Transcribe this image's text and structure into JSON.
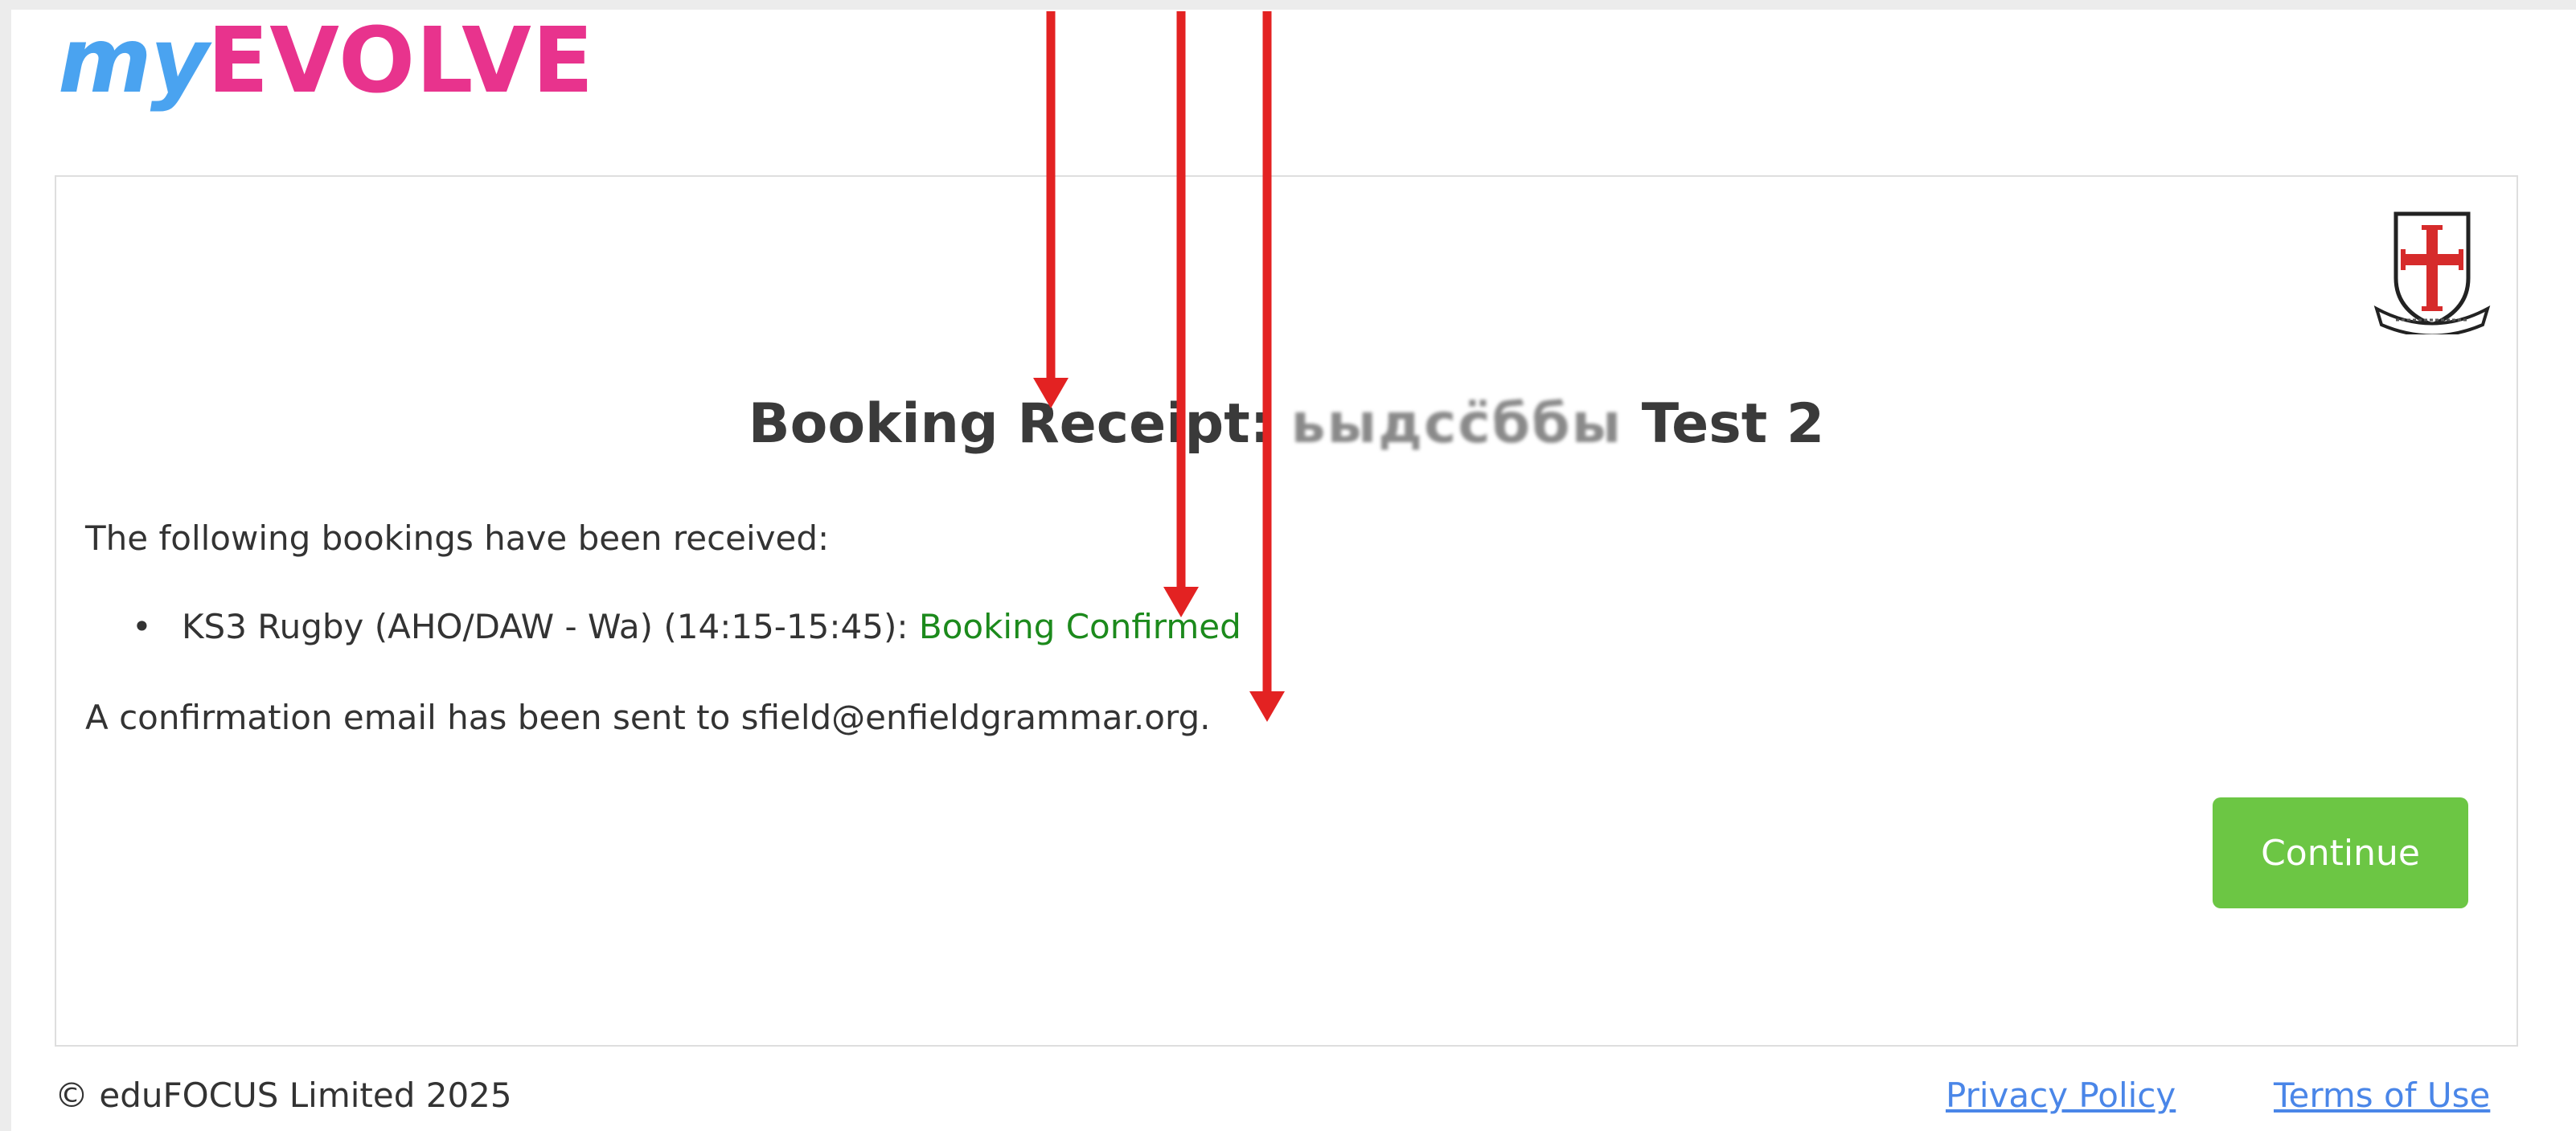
{
  "logo": {
    "my": "my",
    "evolve": "EVOLVE"
  },
  "receipt": {
    "title_prefix": "Booking Receipt:",
    "title_obscured": "ьыдсс̈ббы",
    "title_suffix": "Test 2",
    "intro": "The following bookings have been received:",
    "bookings": [
      {
        "activity": "KS3 Rugby (AHO/DAW - Wa) (14:15-15:45):",
        "status": "Booking Confirmed"
      }
    ],
    "email_note": "A confirmation email has been sent to sfield@enfieldgrammar.org.",
    "continue_label": "Continue"
  },
  "footer": {
    "copyright": "© eduFOCUS Limited 2025",
    "privacy": "Privacy Policy",
    "terms": "Terms of Use"
  },
  "colors": {
    "logo_my": "#4aa3f0",
    "logo_evolve": "#e8338d",
    "status_confirmed": "#1c8a1c",
    "continue_button": "#6cc644",
    "link": "#4a86e8",
    "annotation_arrow": "#e32222"
  },
  "icons": {
    "crest": "school-crest-icon",
    "arrows": "annotation-arrow"
  }
}
